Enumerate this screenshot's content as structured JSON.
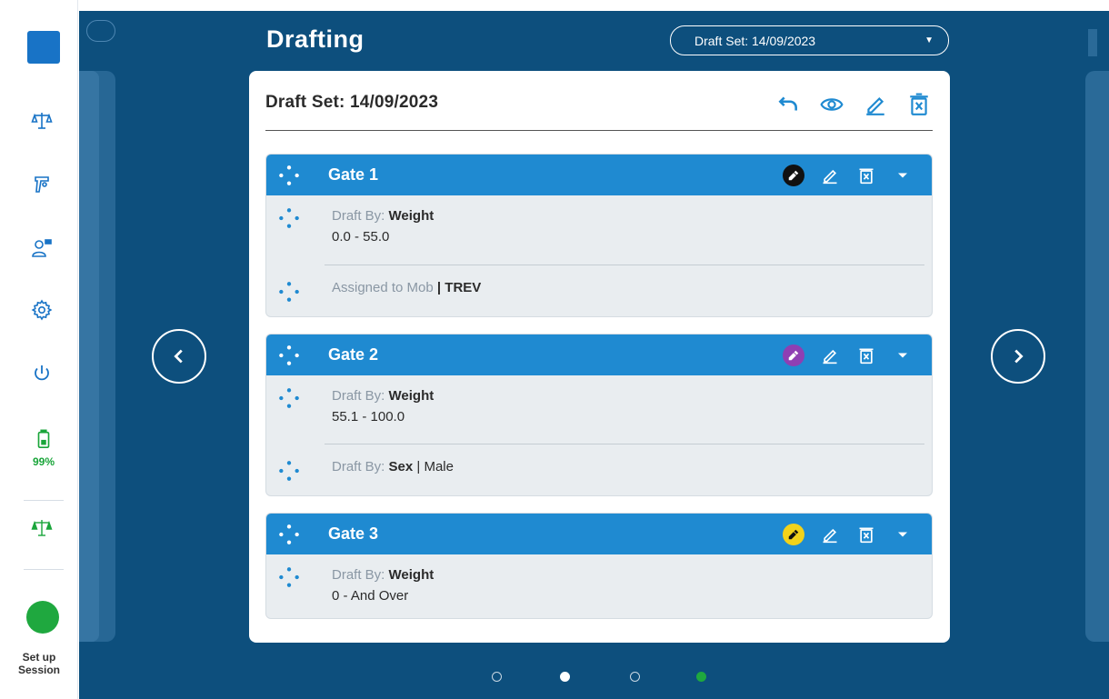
{
  "sidebar": {
    "battery": "99%",
    "session_label_1": "Set up",
    "session_label_2": "Session"
  },
  "header": {
    "title": "Drafting",
    "draft_select_value": "Draft Set: 14/09/2023"
  },
  "card": {
    "title": "Draft Set: 14/09/2023"
  },
  "gates": [
    {
      "name": "Gate 1",
      "color": "#111111",
      "rule1_label": "Draft By: ",
      "rule1_value": "Weight",
      "rule1_range": "0.0 - 55.0",
      "rule2_label": "Assigned to Mob",
      "rule2_sep": " | ",
      "rule2_value": "TREV"
    },
    {
      "name": "Gate 2",
      "color": "#8e3fb3",
      "rule1_label": "Draft By: ",
      "rule1_value": "Weight",
      "rule1_range": "55.1 - 100.0",
      "rule2_label": "Draft By: ",
      "rule2_value": "Sex",
      "rule2_sep": " | ",
      "rule2_extra": "Male"
    },
    {
      "name": "Gate 3",
      "color": "#f2d21b",
      "rule1_label": "Draft By: ",
      "rule1_value": "Weight",
      "rule1_range": "0 - And Over"
    }
  ],
  "colors": {
    "main_bg": "#0d4f7d",
    "gate_header": "#1f8ad1",
    "accent": "#1873c6",
    "status_green": "#1fa83f"
  },
  "pagination": {
    "active_index": 1,
    "total": 4,
    "status_dot_color": "#1fa83f"
  }
}
